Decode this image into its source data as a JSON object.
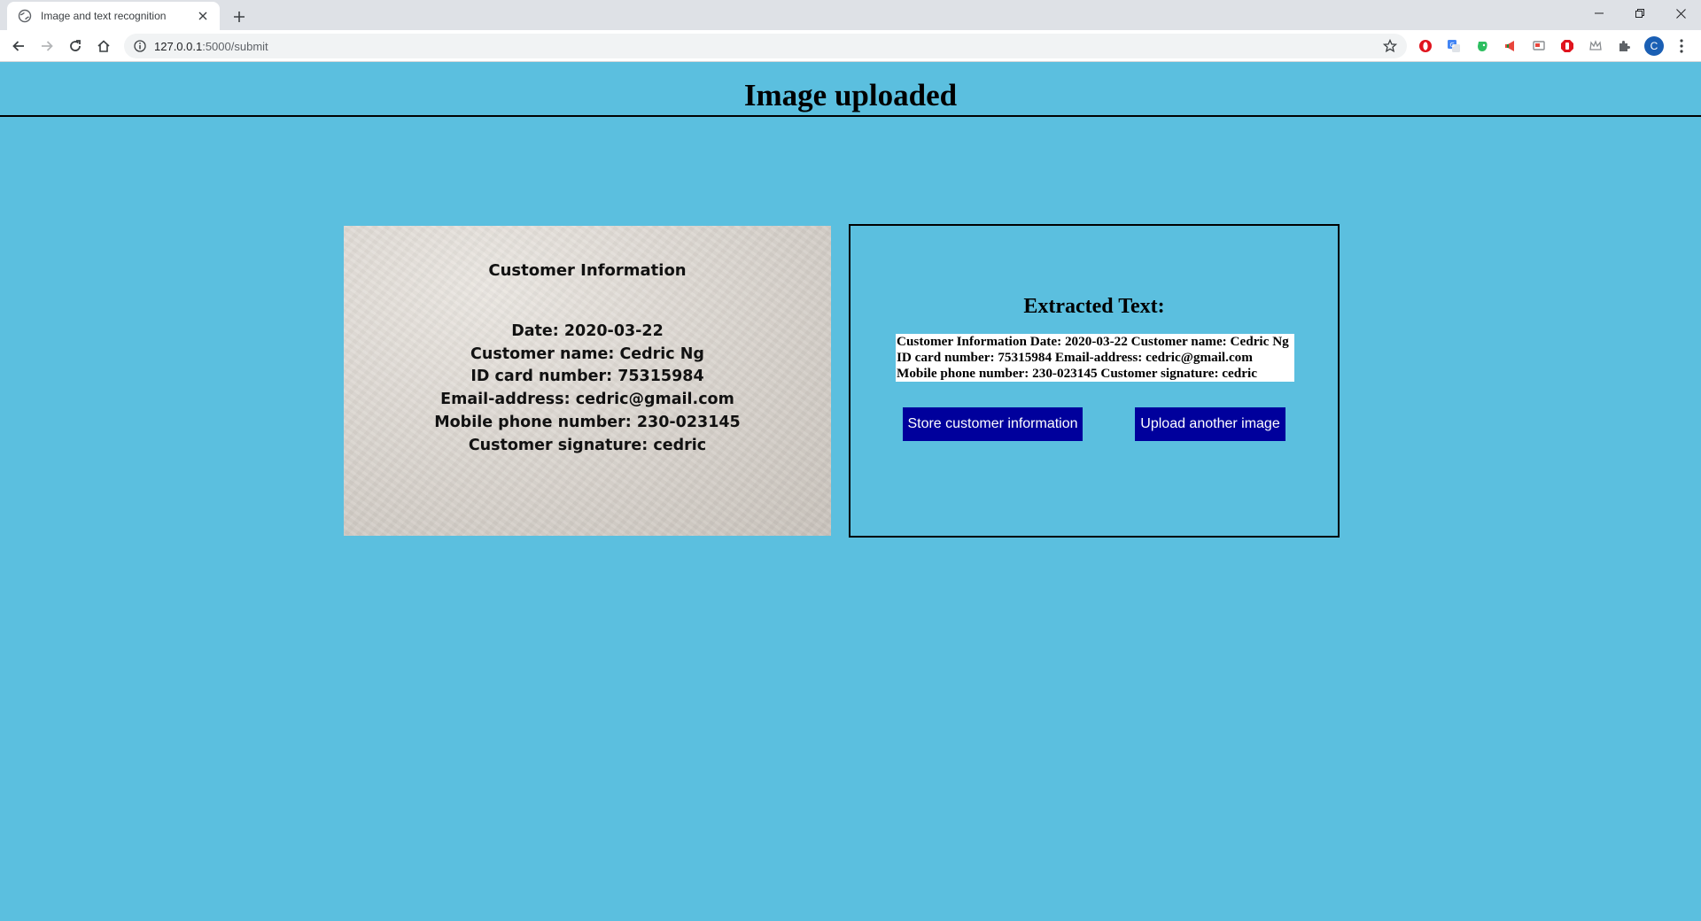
{
  "browser": {
    "tab_title": "Image and text recognition",
    "url_host": "127.0.0.1",
    "url_path": ":5000/submit",
    "profile_initial": "C"
  },
  "page": {
    "title": "Image uploaded"
  },
  "uploaded_image": {
    "heading": "Customer Information",
    "lines": [
      "Date:  2020-03-22",
      "Customer name:  Cedric Ng",
      "ID card number: 75315984",
      "Email-address: cedric@gmail.com",
      "Mobile phone number: 230-023145",
      "Customer signature: cedric"
    ]
  },
  "result": {
    "heading": "Extracted Text:",
    "extracted_text": "Customer Information Date: 2020-03-22 Customer name: Cedric Ng ID card number: 75315984 Email-address: cedric@gmail.com Mobile phone number: 230-023145 Customer signature: cedric",
    "store_button": "Store customer information",
    "upload_button": "Upload another image"
  },
  "colors": {
    "page_background": "#5bbfdf",
    "button_background": "#00009c"
  }
}
